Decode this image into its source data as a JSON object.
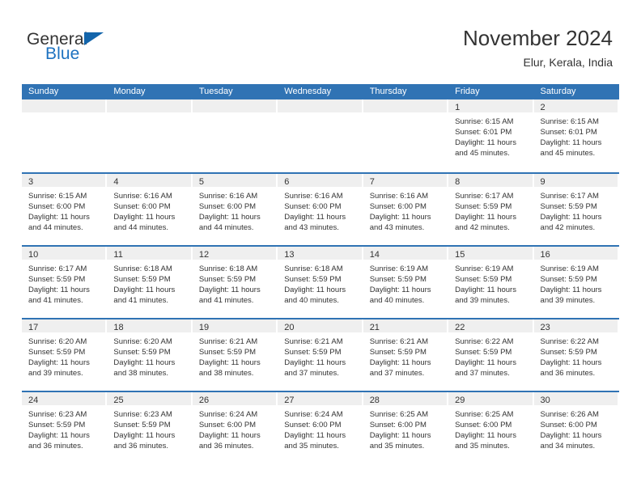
{
  "brand": {
    "name_part1": "General",
    "name_part2": "Blue",
    "triangle_color": "#1365ab",
    "blue_color": "#1d72c0"
  },
  "header": {
    "title": "November 2024",
    "subtitle": "Elur, Kerala, India"
  },
  "theme": {
    "header_blue": "#3073b4",
    "day_band_gray": "#efefef",
    "text_color": "#333333"
  },
  "calendar": {
    "day_headers": [
      "Sunday",
      "Monday",
      "Tuesday",
      "Wednesday",
      "Thursday",
      "Friday",
      "Saturday"
    ],
    "labels": {
      "sunrise": "Sunrise:",
      "sunset": "Sunset:",
      "daylight": "Daylight:"
    },
    "weeks": [
      [
        {
          "day": "",
          "sunrise": "",
          "sunset": "",
          "daylight1": "",
          "daylight2": ""
        },
        {
          "day": "",
          "sunrise": "",
          "sunset": "",
          "daylight1": "",
          "daylight2": ""
        },
        {
          "day": "",
          "sunrise": "",
          "sunset": "",
          "daylight1": "",
          "daylight2": ""
        },
        {
          "day": "",
          "sunrise": "",
          "sunset": "",
          "daylight1": "",
          "daylight2": ""
        },
        {
          "day": "",
          "sunrise": "",
          "sunset": "",
          "daylight1": "",
          "daylight2": ""
        },
        {
          "day": "1",
          "sunrise": "Sunrise: 6:15 AM",
          "sunset": "Sunset: 6:01 PM",
          "daylight1": "Daylight: 11 hours",
          "daylight2": "and 45 minutes."
        },
        {
          "day": "2",
          "sunrise": "Sunrise: 6:15 AM",
          "sunset": "Sunset: 6:01 PM",
          "daylight1": "Daylight: 11 hours",
          "daylight2": "and 45 minutes."
        }
      ],
      [
        {
          "day": "3",
          "sunrise": "Sunrise: 6:15 AM",
          "sunset": "Sunset: 6:00 PM",
          "daylight1": "Daylight: 11 hours",
          "daylight2": "and 44 minutes."
        },
        {
          "day": "4",
          "sunrise": "Sunrise: 6:16 AM",
          "sunset": "Sunset: 6:00 PM",
          "daylight1": "Daylight: 11 hours",
          "daylight2": "and 44 minutes."
        },
        {
          "day": "5",
          "sunrise": "Sunrise: 6:16 AM",
          "sunset": "Sunset: 6:00 PM",
          "daylight1": "Daylight: 11 hours",
          "daylight2": "and 44 minutes."
        },
        {
          "day": "6",
          "sunrise": "Sunrise: 6:16 AM",
          "sunset": "Sunset: 6:00 PM",
          "daylight1": "Daylight: 11 hours",
          "daylight2": "and 43 minutes."
        },
        {
          "day": "7",
          "sunrise": "Sunrise: 6:16 AM",
          "sunset": "Sunset: 6:00 PM",
          "daylight1": "Daylight: 11 hours",
          "daylight2": "and 43 minutes."
        },
        {
          "day": "8",
          "sunrise": "Sunrise: 6:17 AM",
          "sunset": "Sunset: 5:59 PM",
          "daylight1": "Daylight: 11 hours",
          "daylight2": "and 42 minutes."
        },
        {
          "day": "9",
          "sunrise": "Sunrise: 6:17 AM",
          "sunset": "Sunset: 5:59 PM",
          "daylight1": "Daylight: 11 hours",
          "daylight2": "and 42 minutes."
        }
      ],
      [
        {
          "day": "10",
          "sunrise": "Sunrise: 6:17 AM",
          "sunset": "Sunset: 5:59 PM",
          "daylight1": "Daylight: 11 hours",
          "daylight2": "and 41 minutes."
        },
        {
          "day": "11",
          "sunrise": "Sunrise: 6:18 AM",
          "sunset": "Sunset: 5:59 PM",
          "daylight1": "Daylight: 11 hours",
          "daylight2": "and 41 minutes."
        },
        {
          "day": "12",
          "sunrise": "Sunrise: 6:18 AM",
          "sunset": "Sunset: 5:59 PM",
          "daylight1": "Daylight: 11 hours",
          "daylight2": "and 41 minutes."
        },
        {
          "day": "13",
          "sunrise": "Sunrise: 6:18 AM",
          "sunset": "Sunset: 5:59 PM",
          "daylight1": "Daylight: 11 hours",
          "daylight2": "and 40 minutes."
        },
        {
          "day": "14",
          "sunrise": "Sunrise: 6:19 AM",
          "sunset": "Sunset: 5:59 PM",
          "daylight1": "Daylight: 11 hours",
          "daylight2": "and 40 minutes."
        },
        {
          "day": "15",
          "sunrise": "Sunrise: 6:19 AM",
          "sunset": "Sunset: 5:59 PM",
          "daylight1": "Daylight: 11 hours",
          "daylight2": "and 39 minutes."
        },
        {
          "day": "16",
          "sunrise": "Sunrise: 6:19 AM",
          "sunset": "Sunset: 5:59 PM",
          "daylight1": "Daylight: 11 hours",
          "daylight2": "and 39 minutes."
        }
      ],
      [
        {
          "day": "17",
          "sunrise": "Sunrise: 6:20 AM",
          "sunset": "Sunset: 5:59 PM",
          "daylight1": "Daylight: 11 hours",
          "daylight2": "and 39 minutes."
        },
        {
          "day": "18",
          "sunrise": "Sunrise: 6:20 AM",
          "sunset": "Sunset: 5:59 PM",
          "daylight1": "Daylight: 11 hours",
          "daylight2": "and 38 minutes."
        },
        {
          "day": "19",
          "sunrise": "Sunrise: 6:21 AM",
          "sunset": "Sunset: 5:59 PM",
          "daylight1": "Daylight: 11 hours",
          "daylight2": "and 38 minutes."
        },
        {
          "day": "20",
          "sunrise": "Sunrise: 6:21 AM",
          "sunset": "Sunset: 5:59 PM",
          "daylight1": "Daylight: 11 hours",
          "daylight2": "and 37 minutes."
        },
        {
          "day": "21",
          "sunrise": "Sunrise: 6:21 AM",
          "sunset": "Sunset: 5:59 PM",
          "daylight1": "Daylight: 11 hours",
          "daylight2": "and 37 minutes."
        },
        {
          "day": "22",
          "sunrise": "Sunrise: 6:22 AM",
          "sunset": "Sunset: 5:59 PM",
          "daylight1": "Daylight: 11 hours",
          "daylight2": "and 37 minutes."
        },
        {
          "day": "23",
          "sunrise": "Sunrise: 6:22 AM",
          "sunset": "Sunset: 5:59 PM",
          "daylight1": "Daylight: 11 hours",
          "daylight2": "and 36 minutes."
        }
      ],
      [
        {
          "day": "24",
          "sunrise": "Sunrise: 6:23 AM",
          "sunset": "Sunset: 5:59 PM",
          "daylight1": "Daylight: 11 hours",
          "daylight2": "and 36 minutes."
        },
        {
          "day": "25",
          "sunrise": "Sunrise: 6:23 AM",
          "sunset": "Sunset: 5:59 PM",
          "daylight1": "Daylight: 11 hours",
          "daylight2": "and 36 minutes."
        },
        {
          "day": "26",
          "sunrise": "Sunrise: 6:24 AM",
          "sunset": "Sunset: 6:00 PM",
          "daylight1": "Daylight: 11 hours",
          "daylight2": "and 36 minutes."
        },
        {
          "day": "27",
          "sunrise": "Sunrise: 6:24 AM",
          "sunset": "Sunset: 6:00 PM",
          "daylight1": "Daylight: 11 hours",
          "daylight2": "and 35 minutes."
        },
        {
          "day": "28",
          "sunrise": "Sunrise: 6:25 AM",
          "sunset": "Sunset: 6:00 PM",
          "daylight1": "Daylight: 11 hours",
          "daylight2": "and 35 minutes."
        },
        {
          "day": "29",
          "sunrise": "Sunrise: 6:25 AM",
          "sunset": "Sunset: 6:00 PM",
          "daylight1": "Daylight: 11 hours",
          "daylight2": "and 35 minutes."
        },
        {
          "day": "30",
          "sunrise": "Sunrise: 6:26 AM",
          "sunset": "Sunset: 6:00 PM",
          "daylight1": "Daylight: 11 hours",
          "daylight2": "and 34 minutes."
        }
      ]
    ]
  }
}
